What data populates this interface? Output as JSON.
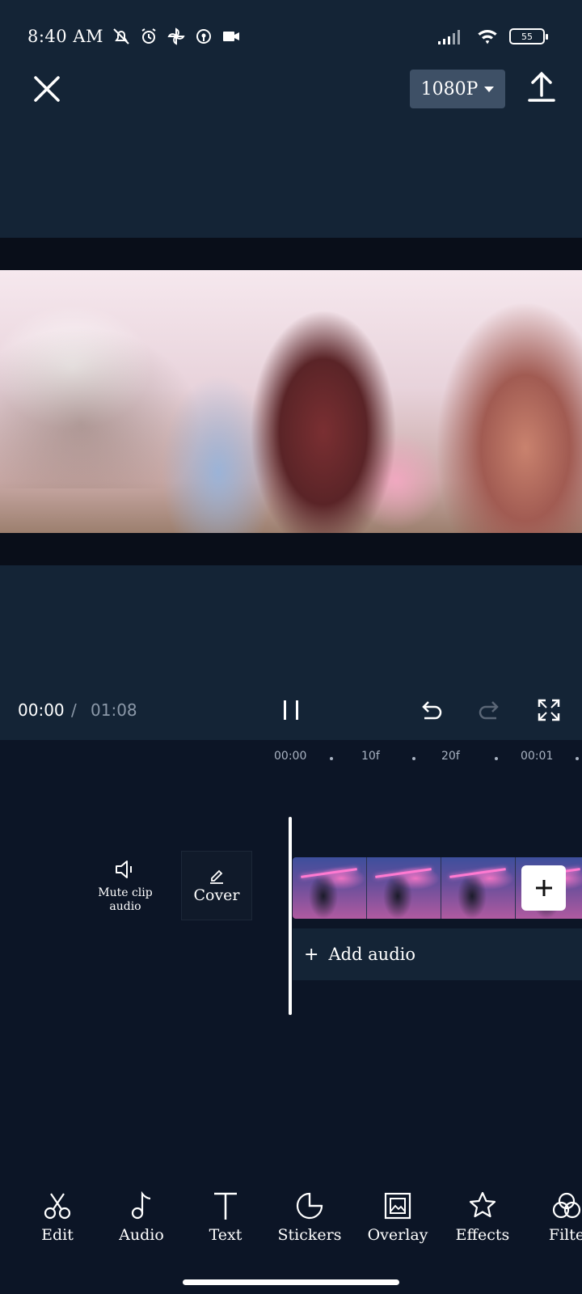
{
  "status_bar": {
    "time": "8:40 AM",
    "battery": "55",
    "icons": [
      "mute-bell-icon",
      "alarm-icon",
      "pinwheel-icon",
      "hotspot-icon",
      "record-icon",
      "video-icon",
      "signal-icon",
      "wifi-icon",
      "battery-icon"
    ]
  },
  "header": {
    "resolution": "1080P",
    "close_icon": "close-icon",
    "export_icon": "export-icon"
  },
  "playback": {
    "current_time": "00:00",
    "separator": "/",
    "total_time": "01:08"
  },
  "ruler": {
    "ticks": [
      "00:00",
      "10f",
      "20f",
      "00:01"
    ]
  },
  "timeline": {
    "mute_label": "Mute clip audio",
    "cover_label": "Cover",
    "add_audio_label": "Add audio"
  },
  "toolbar": {
    "items": [
      {
        "label": "Edit",
        "icon": "scissors-icon"
      },
      {
        "label": "Audio",
        "icon": "music-note-icon"
      },
      {
        "label": "Text",
        "icon": "text-icon"
      },
      {
        "label": "Stickers",
        "icon": "sticker-icon"
      },
      {
        "label": "Overlay",
        "icon": "overlay-icon"
      },
      {
        "label": "Effects",
        "icon": "effects-star-icon"
      },
      {
        "label": "Filte",
        "icon": "filters-icon"
      }
    ]
  },
  "colors": {
    "background": "#0c1526",
    "panel": "#142436",
    "button": "#3e5066",
    "muted_text": "#8b98a8"
  }
}
